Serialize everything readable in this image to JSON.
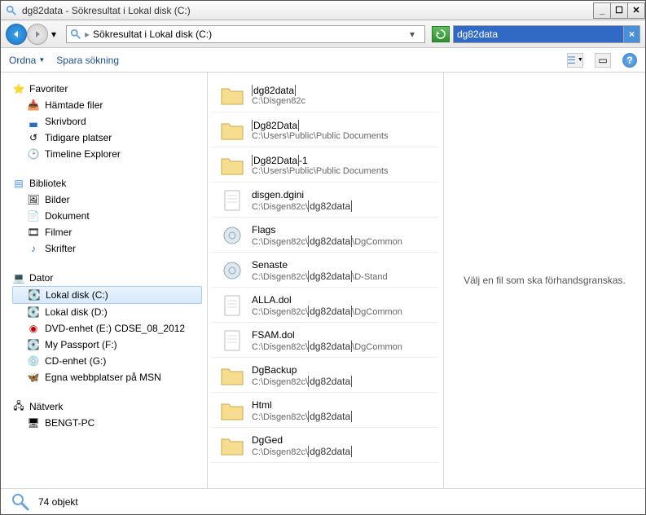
{
  "window": {
    "title": "dg82data - Sökresultat i Lokal disk (C:)"
  },
  "address": {
    "path": "Sökresultat i Lokal disk (C:)"
  },
  "search": {
    "value": "dg82data"
  },
  "toolbar": {
    "organize": "Ordna",
    "save_search": "Spara sökning"
  },
  "sidebar": {
    "favorites": {
      "label": "Favoriter",
      "items": [
        {
          "label": "Hämtade filer"
        },
        {
          "label": "Skrivbord"
        },
        {
          "label": "Tidigare platser"
        },
        {
          "label": "Timeline Explorer"
        }
      ]
    },
    "libraries": {
      "label": "Bibliotek",
      "items": [
        {
          "label": "Bilder"
        },
        {
          "label": "Dokument"
        },
        {
          "label": "Filmer"
        },
        {
          "label": "Skrifter"
        }
      ]
    },
    "computer": {
      "label": "Dator",
      "items": [
        {
          "label": "Lokal disk (C:)",
          "selected": true
        },
        {
          "label": "Lokal disk (D:)"
        },
        {
          "label": "DVD-enhet (E:) CDSE_08_2012"
        },
        {
          "label": "My Passport (F:)"
        },
        {
          "label": "CD-enhet (G:)"
        },
        {
          "label": "Egna webbplatser på MSN"
        }
      ]
    },
    "network": {
      "label": "Nätverk",
      "items": [
        {
          "label": "BENGT-PC"
        }
      ]
    }
  },
  "results": [
    {
      "icon": "folder",
      "name_pre": "",
      "name_hl": "dg82data",
      "name_post": "",
      "path_pre": "C:\\Disgen82c",
      "path_hl": "",
      "path_post": ""
    },
    {
      "icon": "folder",
      "name_pre": "",
      "name_hl": "Dg82Data",
      "name_post": "",
      "path_pre": "C:\\Users\\Public\\Public Documents",
      "path_hl": "",
      "path_post": ""
    },
    {
      "icon": "folder",
      "name_pre": "",
      "name_hl": "Dg82Data",
      "name_post": "-1",
      "path_pre": "C:\\Users\\Public\\Public Documents",
      "path_hl": "",
      "path_post": ""
    },
    {
      "icon": "file",
      "name_pre": "disgen.dgini",
      "name_hl": "",
      "name_post": "",
      "path_pre": "C:\\Disgen82c\\",
      "path_hl": "dg82data",
      "path_post": ""
    },
    {
      "icon": "gear",
      "name_pre": "Flags",
      "name_hl": "",
      "name_post": "",
      "path_pre": "C:\\Disgen82c\\",
      "path_hl": "dg82data",
      "path_post": "\\DgCommon"
    },
    {
      "icon": "gear",
      "name_pre": "Senaste",
      "name_hl": "",
      "name_post": "",
      "path_pre": "C:\\Disgen82c\\",
      "path_hl": "dg82data",
      "path_post": "\\D-Stand"
    },
    {
      "icon": "file",
      "name_pre": "ALLA.dol",
      "name_hl": "",
      "name_post": "",
      "path_pre": "C:\\Disgen82c\\",
      "path_hl": "dg82data",
      "path_post": "\\DgCommon"
    },
    {
      "icon": "file",
      "name_pre": "FSAM.dol",
      "name_hl": "",
      "name_post": "",
      "path_pre": "C:\\Disgen82c\\",
      "path_hl": "dg82data",
      "path_post": "\\DgCommon"
    },
    {
      "icon": "folder",
      "name_pre": "DgBackup",
      "name_hl": "",
      "name_post": "",
      "path_pre": "C:\\Disgen82c\\",
      "path_hl": "dg82data",
      "path_post": ""
    },
    {
      "icon": "folder",
      "name_pre": "Html",
      "name_hl": "",
      "name_post": "",
      "path_pre": "C:\\Disgen82c\\",
      "path_hl": "dg82data",
      "path_post": ""
    },
    {
      "icon": "folder",
      "name_pre": "DgGed",
      "name_hl": "",
      "name_post": "",
      "path_pre": "C:\\Disgen82c\\",
      "path_hl": "dg82data",
      "path_post": ""
    }
  ],
  "preview": {
    "message": "Välj en fil som ska förhandsgranskas."
  },
  "status": {
    "count": "74 objekt"
  }
}
